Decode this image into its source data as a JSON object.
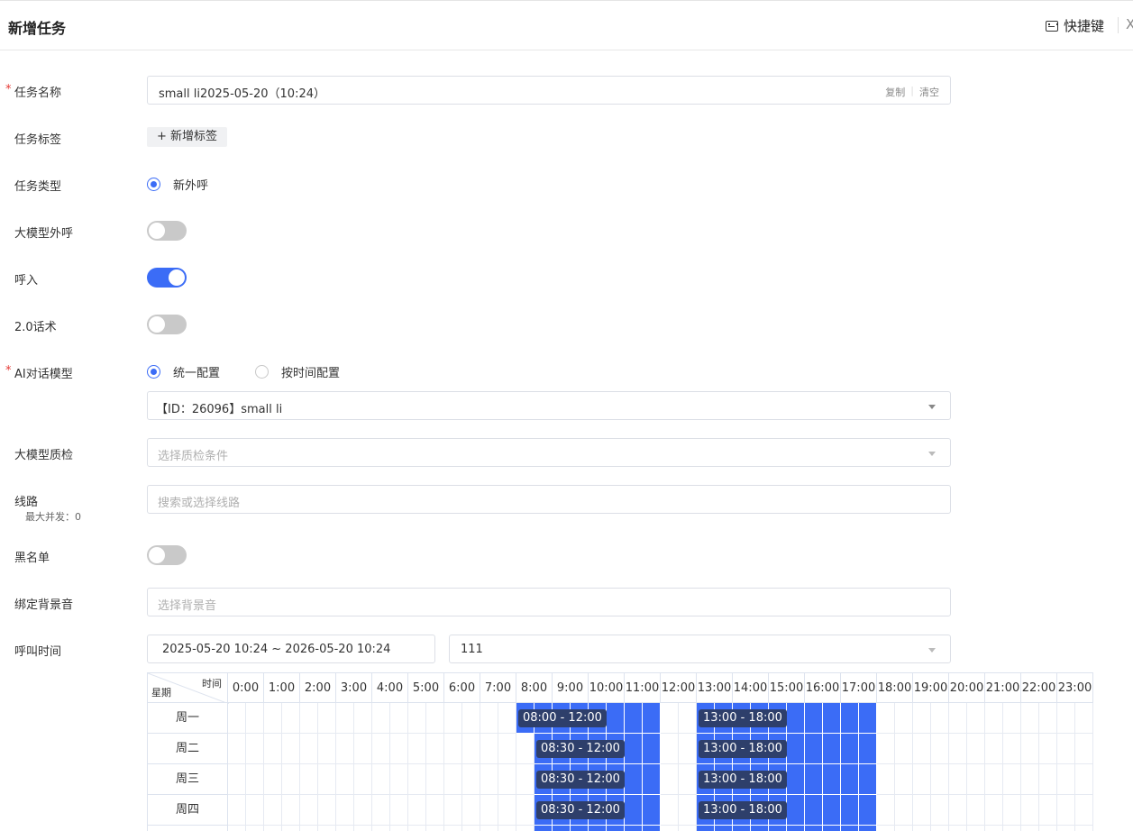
{
  "header": {
    "title": "新增任务",
    "shortcut_label": "快捷键",
    "close_glyph": "X"
  },
  "form": {
    "task_name": {
      "label": "任务名称",
      "value": "small li2025-05-20（10:24）",
      "copy": "复制",
      "clear": "清空"
    },
    "task_tag": {
      "label": "任务标签",
      "add_tag": "+ 新增标签"
    },
    "task_type": {
      "label": "任务类型",
      "option": "新外呼"
    },
    "llm_outbound": {
      "label": "大模型外呼",
      "on": false
    },
    "inbound": {
      "label": "呼入",
      "on": true
    },
    "script_v2": {
      "label": "2.0话术",
      "on": false
    },
    "ai_model": {
      "label": "AI对话模型",
      "opt_unified": "统一配置",
      "opt_by_time": "按时间配置",
      "selected": "【ID：26096】small li"
    },
    "llm_qc": {
      "label": "大模型质检",
      "placeholder": "选择质检条件"
    },
    "line": {
      "label": "线路",
      "sub": "最大并发：0",
      "placeholder": "搜索或选择线路"
    },
    "blacklist": {
      "label": "黑名单",
      "on": false
    },
    "bg_audio": {
      "label": "绑定背景音",
      "placeholder": "选择背景音"
    },
    "call_time": {
      "label": "呼叫时间",
      "range": "2025-05-20 10:24 ~ 2026-05-20 10:24",
      "schedule": "111"
    }
  },
  "grid": {
    "corner_time": "时间",
    "corner_week": "星期",
    "hours": [
      "0:00",
      "1:00",
      "2:00",
      "3:00",
      "4:00",
      "5:00",
      "6:00",
      "7:00",
      "8:00",
      "9:00",
      "10:00",
      "11:00",
      "12:00",
      "13:00",
      "14:00",
      "15:00",
      "16:00",
      "17:00",
      "18:00",
      "19:00",
      "20:00",
      "21:00",
      "22:00",
      "23:00"
    ],
    "days": [
      {
        "name": "周一",
        "ranges": [
          {
            "start": "08:00",
            "end": "12:00",
            "label": "08:00 - 12:00"
          },
          {
            "start": "13:00",
            "end": "18:00",
            "label": "13:00 - 18:00"
          }
        ]
      },
      {
        "name": "周二",
        "ranges": [
          {
            "start": "08:30",
            "end": "12:00",
            "label": "08:30 - 12:00"
          },
          {
            "start": "13:00",
            "end": "18:00",
            "label": "13:00 - 18:00"
          }
        ]
      },
      {
        "name": "周三",
        "ranges": [
          {
            "start": "08:30",
            "end": "12:00",
            "label": "08:30 - 12:00"
          },
          {
            "start": "13:00",
            "end": "18:00",
            "label": "13:00 - 18:00"
          }
        ]
      },
      {
        "name": "周四",
        "ranges": [
          {
            "start": "08:30",
            "end": "12:00",
            "label": "08:30 - 12:00"
          },
          {
            "start": "13:00",
            "end": "18:00",
            "label": "13:00 - 18:00"
          }
        ]
      },
      {
        "name": "",
        "ranges": [
          {
            "start": "08:30",
            "end": "12:00",
            "label": ""
          },
          {
            "start": "13:00",
            "end": "18:00",
            "label": ""
          }
        ]
      }
    ],
    "colors": {
      "selected": "#3b6cf6",
      "label_bg": "#2e3f6b",
      "line": "#dde3ee"
    }
  }
}
